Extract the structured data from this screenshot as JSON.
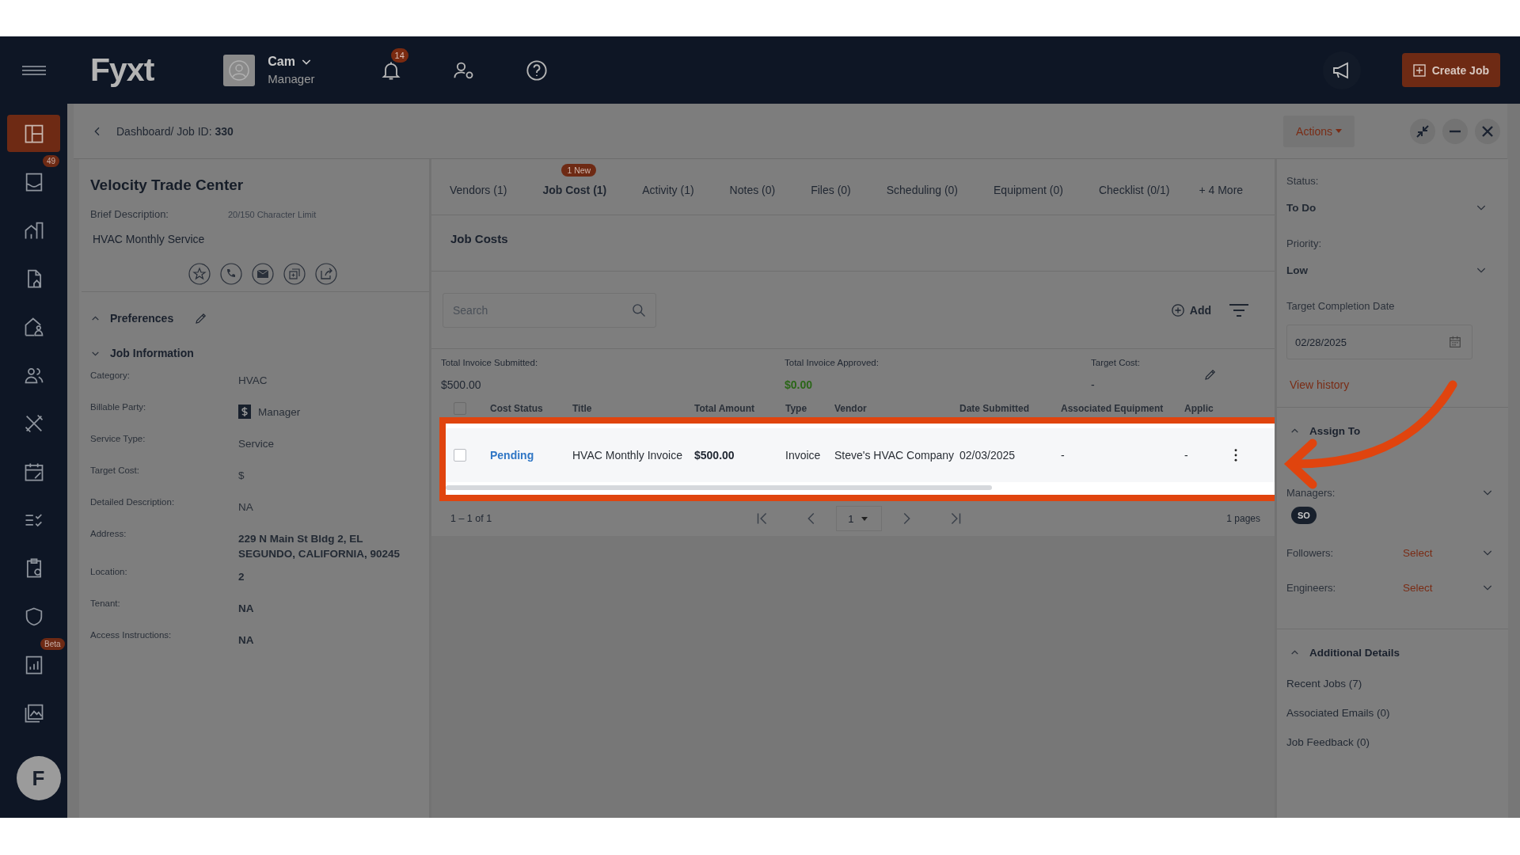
{
  "top_bar": {
    "logo": "Fyxt",
    "user_name": "Cam",
    "user_role": "Manager",
    "notification_count": "14",
    "create_button": "Create Job"
  },
  "sidebar": {
    "items": [
      {
        "selected": true
      },
      {
        "selected": false,
        "badge": "49"
      },
      {
        "selected": false
      },
      {
        "selected": false
      },
      {
        "selected": false
      },
      {
        "selected": false
      },
      {
        "selected": false
      },
      {
        "selected": false
      },
      {
        "selected": false
      },
      {
        "selected": false
      },
      {
        "selected": false
      },
      {
        "selected": false,
        "badge": "Beta"
      },
      {
        "selected": false
      }
    ],
    "avatar_letter": "F"
  },
  "breadcrumb": {
    "path": "Dashboard/ Job ID:",
    "job_id": "330"
  },
  "actions_button": "Actions",
  "job": {
    "title": "Velocity Trade Center",
    "brief_label": "Brief Description:",
    "char_limit": "20/150 Character Limit",
    "brief": "HVAC Monthly Service"
  },
  "sections": [
    {
      "title": "Preferences",
      "expanded": false,
      "editable": true
    },
    {
      "title": "Job Information",
      "expanded": true,
      "editable": false
    }
  ],
  "job_info": [
    {
      "label": "Category:",
      "value": "HVAC",
      "kind": "text"
    },
    {
      "label": "Billable Party:",
      "value": "Manager",
      "kind": "billable"
    },
    {
      "label": "Service Type:",
      "value": "Service",
      "kind": "text"
    },
    {
      "label": "Target Cost:",
      "value": "$",
      "kind": "text"
    },
    {
      "label": "Detailed Description:",
      "value": "NA",
      "kind": "text"
    },
    {
      "label": "Address:",
      "value": "229 N Main St Bldg 2, EL SEGUNDO, CALIFORNIA, 90245",
      "kind": "text"
    },
    {
      "label": "Location:",
      "value": "2",
      "kind": "text"
    },
    {
      "label": "Tenant:",
      "value": "NA",
      "kind": "text"
    },
    {
      "label": "Access Instructions:",
      "value": "NA",
      "kind": "text"
    }
  ],
  "tabs": [
    {
      "label": "Vendors (1)",
      "selected": false
    },
    {
      "label": "Job Cost (1)",
      "selected": true,
      "badge": "1 New"
    },
    {
      "label": "Activity (1)",
      "selected": false
    },
    {
      "label": "Notes (0)",
      "selected": false
    },
    {
      "label": "Files (0)",
      "selected": false
    },
    {
      "label": "Scheduling (0)",
      "selected": false
    },
    {
      "label": "Equipment (0)",
      "selected": false
    },
    {
      "label": "Checklist (0/1)",
      "selected": false
    }
  ],
  "more_tabs": "+ 4 More",
  "job_costs": {
    "title": "Job Costs",
    "search_placeholder": "Search",
    "add_label": "Add",
    "select_all_checked": false,
    "totals": [
      {
        "label": "Total Invoice Submitted:",
        "value": "$500.00",
        "kind": "plain"
      },
      {
        "label": "Total Invoice Approved:",
        "value": "$0.00",
        "kind": "positive"
      },
      {
        "label": "Target Cost:",
        "value": "-",
        "kind": "plain"
      }
    ],
    "columns": [
      "Cost Status",
      "Title",
      "Total Amount",
      "Type",
      "Vendor",
      "Date Submitted",
      "Associated Equipment",
      "Applic"
    ],
    "rows": [
      {
        "checked": false,
        "status": "Pending",
        "title": "HVAC Monthly Invoice",
        "amount": "$500.00",
        "type": "Invoice",
        "vendor": "Steve's HVAC Company",
        "date": "02/03/2025",
        "equipment": "-",
        "column_8": "-"
      }
    ],
    "range": "1 – 1 of 1",
    "page": "1",
    "pages": "1 pages"
  },
  "details": {
    "status_label": "Status:",
    "status": "To Do",
    "priority_label": "Priority:",
    "priority": "Low",
    "date_label": "Target Completion Date",
    "date": "02/28/2025",
    "history_link": "View history"
  },
  "assign": {
    "title": "Assign To",
    "expanded": true,
    "managers_label": "Managers:",
    "manager_chip": "SO",
    "followers_label": "Followers:",
    "followers": "Select",
    "engineers_label": "Engineers:",
    "engineers": "Select"
  },
  "additional": {
    "title": "Additional Details",
    "expanded": true,
    "links": [
      "Recent Jobs (7)",
      "Associated Emails (0)",
      "Job Feedback (0)"
    ]
  }
}
